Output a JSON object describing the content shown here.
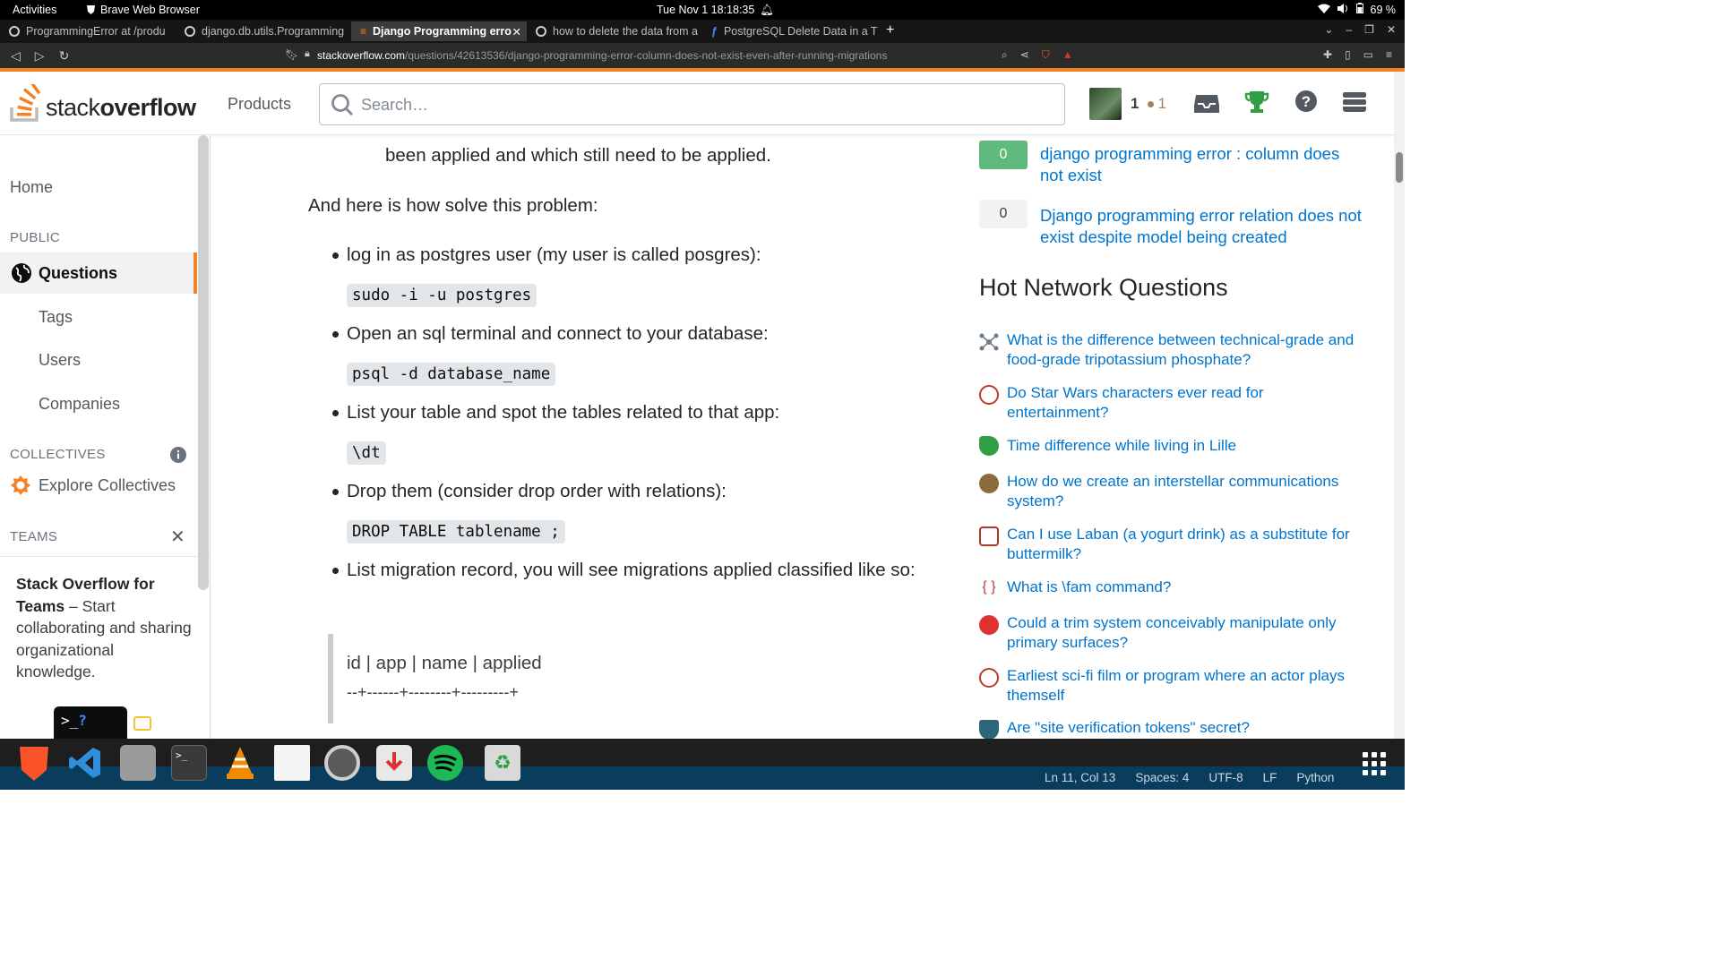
{
  "system": {
    "activities": "Activities",
    "app_name": "Brave Web Browser",
    "datetime": "Tue Nov 1  18:18:35",
    "battery": "69 %"
  },
  "tabs": [
    {
      "title": "ProgrammingError at /produ",
      "active": false
    },
    {
      "title": "django.db.utils.Programming",
      "active": false
    },
    {
      "title": "Django Programming erro",
      "active": true
    },
    {
      "title": "how to delete the data from a",
      "active": false
    },
    {
      "title": "PostgreSQL Delete Data in a T",
      "active": false
    }
  ],
  "address": {
    "domain": "stackoverflow.com",
    "path": "/questions/42613536/django-programming-error-column-does-not-exist-even-after-running-migrations"
  },
  "header": {
    "logo_light": "stack",
    "logo_bold": "overflow",
    "products": "Products",
    "search_placeholder": "Search…",
    "reputation": "1",
    "bronze": "1"
  },
  "leftnav": {
    "home": "Home",
    "public": "PUBLIC",
    "questions": "Questions",
    "tags": "Tags",
    "users": "Users",
    "companies": "Companies",
    "collectives": "COLLECTIVES",
    "explore": "Explore Collectives",
    "teams": "TEAMS",
    "teams_title": "Stack Overflow for Teams",
    "teams_text": " – Start collaborating and sharing organizational knowledge."
  },
  "answer": {
    "top_line": "been applied and which still need to be applied.",
    "intro": "And here is how solve this problem:",
    "steps": [
      {
        "text": "log in as postgres user (my user is called posgres):",
        "code": "sudo -i -u postgres"
      },
      {
        "text": "Open an sql terminal and connect to your database:",
        "code": "psql -d database_name"
      },
      {
        "text": "List your table and spot the tables related to that app:",
        "code": "\\dt"
      },
      {
        "text": "Drop them (consider drop order with relations):",
        "code": "DROP TABLE tablename ;"
      },
      {
        "text": "List migration record, you will see migrations applied classified like so:",
        "code": ""
      }
    ],
    "quote_line1": "id | app | name | applied",
    "quote_line2": "--+------+--------+---------+"
  },
  "related": [
    {
      "votes": "0",
      "answered": true,
      "title": "django programming error : column does not exist"
    },
    {
      "votes": "0",
      "answered": false,
      "title": "Django programming error relation does not exist despite model being created"
    }
  ],
  "hnq": {
    "title": "Hot Network Questions",
    "items": [
      {
        "title": "What is the difference between technical-grade and food-grade tripotassium phosphate?",
        "site_color": "#6b7b8c"
      },
      {
        "title": "Do Star Wars characters ever read for entertainment?",
        "site_color": "#c0392b"
      },
      {
        "title": "Time difference while living in Lille",
        "site_color": "#2f9e44"
      },
      {
        "title": "How do we create an interstellar communications system?",
        "site_color": "#8a6d3b"
      },
      {
        "title": "Can I use Laban (a yogurt drink) as a substitute for buttermilk?",
        "site_color": "#b03a2e"
      },
      {
        "title": "What is \\fam command?",
        "site_color": "#c0392b"
      },
      {
        "title": "Could a trim system conceivably manipulate only primary surfaces?",
        "site_color": "#e03131"
      },
      {
        "title": "Earliest sci-fi film or program where an actor plays themself",
        "site_color": "#c0392b"
      },
      {
        "title": "Are \"site verification tokens\" secret?",
        "site_color": "#2b6777"
      }
    ]
  },
  "vscode_status": {
    "position": "Ln 11, Col 13",
    "spaces": "Spaces: 4",
    "encoding": "UTF-8",
    "eol": "LF",
    "language": "Python"
  },
  "colors": {
    "accent": "#f48225",
    "link": "#0074cc",
    "answered": "#5eba7d"
  }
}
